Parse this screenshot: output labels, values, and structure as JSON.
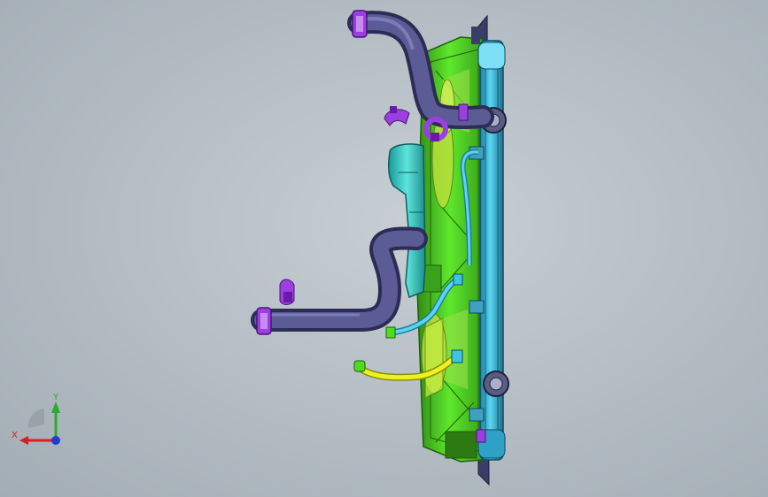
{
  "viewport": {
    "background": "#b7c0c7"
  },
  "model": {
    "colors": {
      "shroud": "#4fdc1f",
      "shroud_dark": "#2f8a14",
      "radiator": "#3fc4e6",
      "radiator_dark": "#1d6f8c",
      "reservoir": "#3fd4cf",
      "hose": "#4a4a80",
      "hose_dark": "#2c2c55",
      "clamp": "#9b3fe0",
      "yellow_hose": "#e8f01e",
      "fan_blade": "#c0e63a"
    }
  },
  "triad": {
    "x_label": "X",
    "y_label": "Y",
    "x_color": "#d81e1e",
    "y_color": "#2ea82e",
    "z_color": "#1e3cd8"
  }
}
